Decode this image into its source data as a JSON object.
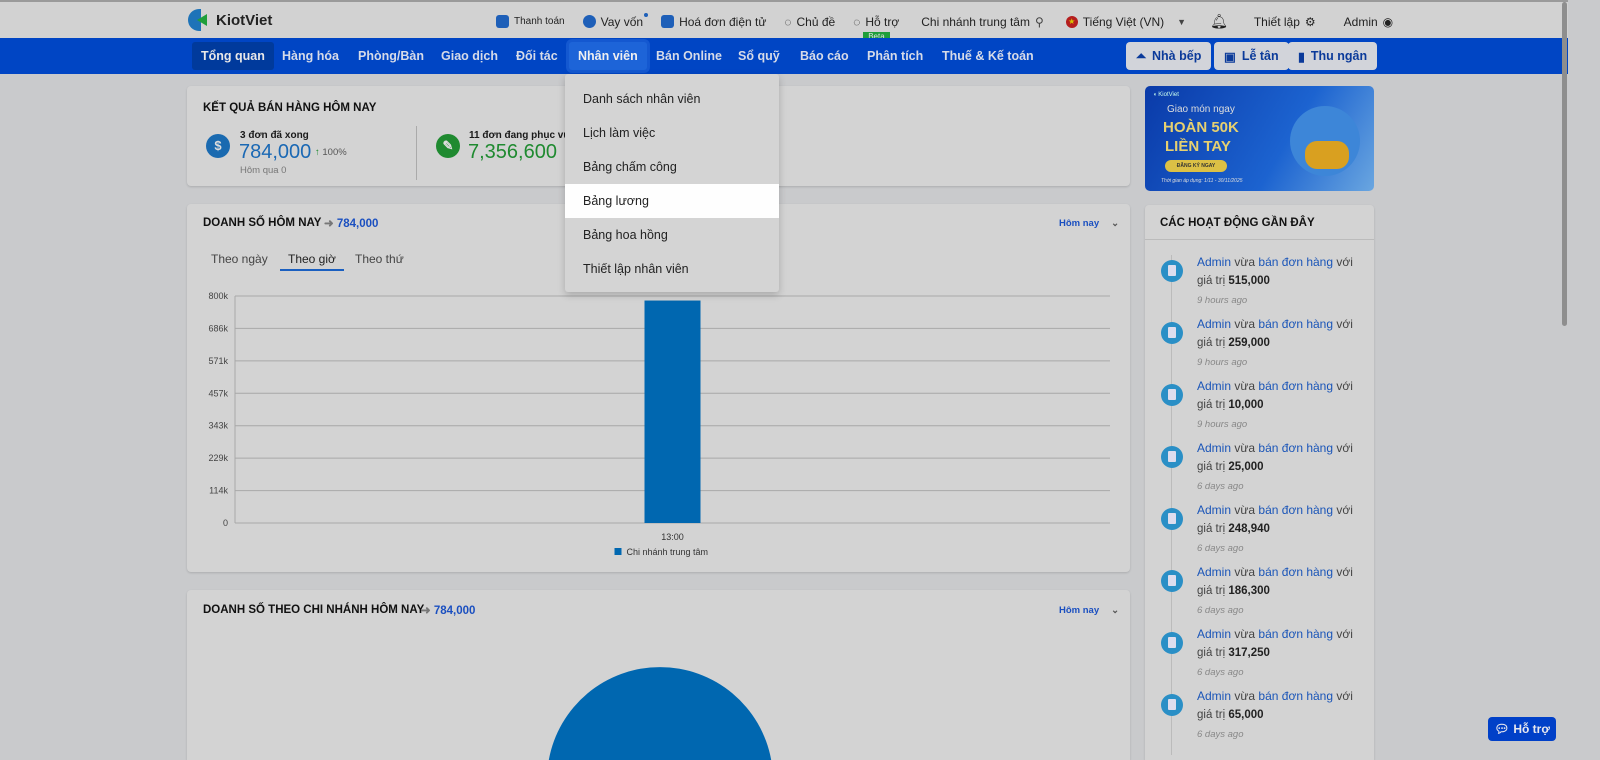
{
  "topbar": {
    "brand": "KiotViet",
    "links": [
      {
        "label": "Thanh toán",
        "icon": "wallet-icon"
      },
      {
        "label": "Vay vốn",
        "icon": "money-bag-icon"
      },
      {
        "label": "Hoá đơn điện tử",
        "icon": "invoice-icon"
      },
      {
        "label": "Chủ đề",
        "icon": "palette-icon"
      },
      {
        "label": "Hỗ trợ",
        "icon": "chat-icon",
        "badge": "Beta"
      }
    ],
    "branch": "Chi nhánh trung tâm",
    "language": "Tiếng Việt (VN)",
    "settings": "Thiết lập",
    "user": "Admin"
  },
  "nav": {
    "items": [
      "Tổng quan",
      "Hàng hóa",
      "Phòng/Bàn",
      "Giao dịch",
      "Đối tác",
      "Nhân viên",
      "Bán Online",
      "Sổ quỹ",
      "Báo cáo",
      "Phân tích",
      "Thuế & Kế toán"
    ],
    "buttons": [
      "Nhà bếp",
      "Lễ tân",
      "Thu ngân"
    ]
  },
  "dropdown": {
    "items": [
      "Danh sách nhân viên",
      "Lịch làm việc",
      "Bảng chấm công",
      "Bảng lương",
      "Bảng hoa hồng",
      "Thiết lập nhân viên"
    ],
    "highlighted": "Bảng lương"
  },
  "results": {
    "title": "KẾT QUẢ BÁN HÀNG HÔM NAY",
    "done_label": "3 đơn đã xong",
    "done_value": "784,000",
    "change": "100%",
    "yesterday": "Hôm qua 0",
    "serving_label": "11 đơn đang phục vụ",
    "serving_value": "7,356,600"
  },
  "sales_today": {
    "title": "DOANH SỐ HÔM NAY",
    "total": "784,000",
    "period": "Hôm nay",
    "tabs": [
      "Theo ngày",
      "Theo giờ",
      "Theo thứ"
    ],
    "active_tab": "Theo giờ"
  },
  "chart_data": {
    "type": "bar",
    "categories": [
      "13:00"
    ],
    "series": [
      {
        "name": "Chi nhánh trung tâm",
        "values": [
          784000
        ],
        "color": "#0067b0"
      }
    ],
    "yticks": [
      "0",
      "114k",
      "229k",
      "343k",
      "457k",
      "571k",
      "686k",
      "800k"
    ],
    "ylim": [
      0,
      800000
    ],
    "legend": "bottom",
    "grid": true
  },
  "branch_sales": {
    "title": "DOANH SỐ THEO CHI NHÁNH HÔM NAY",
    "total": "784,000",
    "period": "Hôm nay"
  },
  "activity": {
    "title": "CÁC HOẠT ĐỘNG GẦN ĐÂY",
    "items": [
      {
        "user": "Admin",
        "mid": "vừa",
        "action": "bán đơn hàng",
        "end": "với",
        "prefix": "giá trị",
        "value": "515,000",
        "time": "9 hours ago"
      },
      {
        "user": "Admin",
        "mid": "vừa",
        "action": "bán đơn hàng",
        "end": "với",
        "prefix": "giá trị",
        "value": "259,000",
        "time": "9 hours ago"
      },
      {
        "user": "Admin",
        "mid": "vừa",
        "action": "bán đơn hàng",
        "end": "với",
        "prefix": "giá trị",
        "value": "10,000",
        "time": "9 hours ago"
      },
      {
        "user": "Admin",
        "mid": "vừa",
        "action": "bán đơn hàng",
        "end": "với",
        "prefix": "giá trị",
        "value": "25,000",
        "time": "6 days ago"
      },
      {
        "user": "Admin",
        "mid": "vừa",
        "action": "bán đơn hàng",
        "end": "với",
        "prefix": "giá trị",
        "value": "248,940",
        "time": "6 days ago"
      },
      {
        "user": "Admin",
        "mid": "vừa",
        "action": "bán đơn hàng",
        "end": "với",
        "prefix": "giá trị",
        "value": "186,300",
        "time": "6 days ago"
      },
      {
        "user": "Admin",
        "mid": "vừa",
        "action": "bán đơn hàng",
        "end": "với",
        "prefix": "giá trị",
        "value": "317,250",
        "time": "6 days ago"
      },
      {
        "user": "Admin",
        "mid": "vừa",
        "action": "bán đơn hàng",
        "end": "với",
        "prefix": "giá trị",
        "value": "65,000",
        "time": "6 days ago"
      }
    ]
  },
  "banner": {
    "line1": "Giao món ngay",
    "line2": "HOÀN 50K",
    "line3": "LIỀN TAY",
    "cta": "ĐĂNG KÝ NGAY",
    "note": "Thời gian áp dụng: 1/11 - 30/11/2025"
  },
  "help_button": "Hỗ trợ"
}
